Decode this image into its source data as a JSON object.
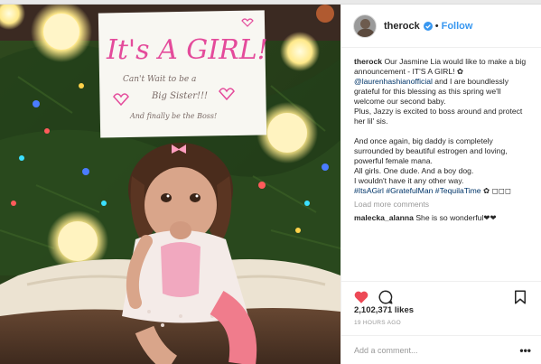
{
  "post": {
    "username": "therock",
    "follow_label": "Follow",
    "separator": "•",
    "caption": {
      "username": "therock",
      "line1": "Our Jasmine Lia would like to make a big announcement - IT'S A GIRL! ✿",
      "mention": "@laurenhashianofficial",
      "line2": " and I are boundlessly grateful for this blessing as this spring we'll welcome our second baby.",
      "line3": "Plus, Jazzy is excited to boss around and protect her lil' sis.",
      "line4": "And once again, big daddy is completely surrounded by beautiful estrogen and loving, powerful female mana.",
      "line5": "All girls. One dude. And a boy dog.",
      "line6": "I wouldn't have it any other way.",
      "hashtags": "#ItsAGirl #GratefulMan #TequilaTime",
      "emoji_tail": " ✿ ◻◻◻"
    },
    "load_more": "Load more comments",
    "comments": [
      {
        "username": "malecka_alanna",
        "text": "She is so wonderful❤❤"
      }
    ],
    "likes": "2,102,371 likes",
    "time": "19 HOURS AGO",
    "comment_placeholder": "Add a comment...",
    "more_label": "•••"
  },
  "photo": {
    "sign_title": "It's A GIRL!",
    "sign_line1": "Can't Wait to be a",
    "sign_line2": "Big Sister!!!",
    "sign_line3": "And finally be the Boss!"
  },
  "icons": [
    "verified-badge-icon",
    "heart-icon",
    "comment-icon",
    "bookmark-icon",
    "more-options-icon"
  ],
  "colors": {
    "link": "#003569",
    "accent": "#3897f0",
    "like": "#ed4956",
    "muted": "#999999"
  }
}
